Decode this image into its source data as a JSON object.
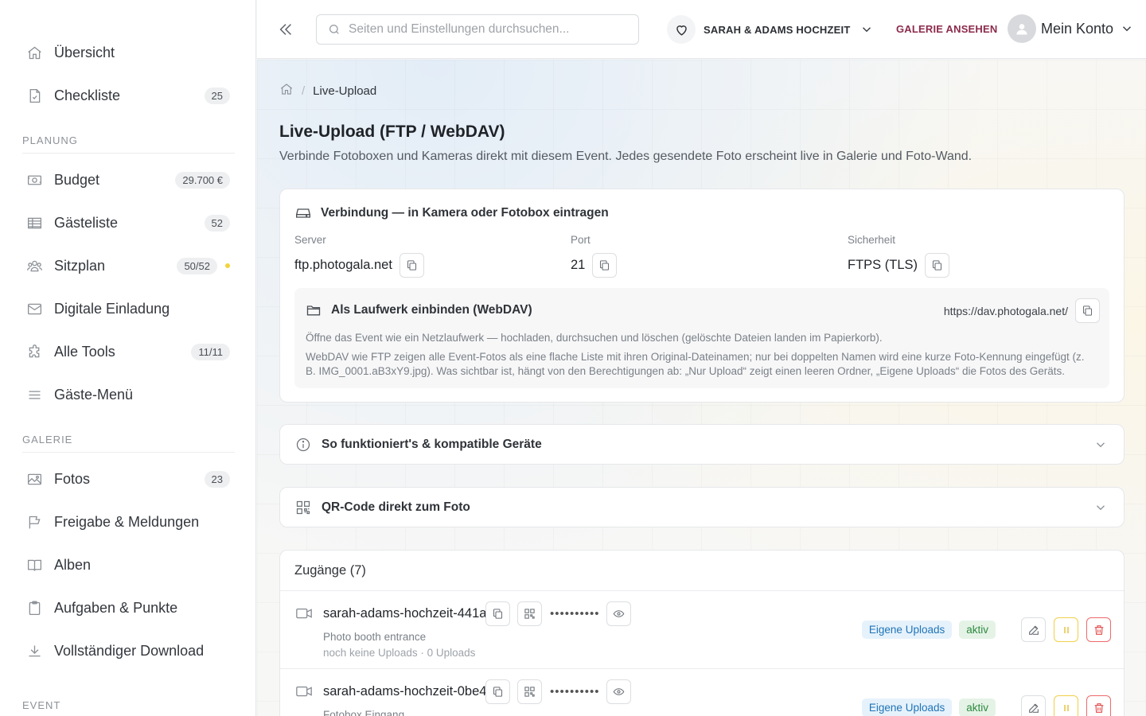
{
  "sidebar": {
    "items_top": [
      {
        "label": "Übersicht",
        "icon": "home-icon"
      },
      {
        "label": "Checkliste",
        "icon": "checklist-icon",
        "badge": "25"
      }
    ],
    "planung_label": "PLANUNG",
    "items_planung": [
      {
        "label": "Budget",
        "icon": "money-icon",
        "badge": "29.700 €"
      },
      {
        "label": "Gästeliste",
        "icon": "table-icon",
        "badge": "52"
      },
      {
        "label": "Sitzplan",
        "icon": "users-icon",
        "badge": "50/52",
        "dot": true
      },
      {
        "label": "Digitale Einladung",
        "icon": "mail-icon"
      },
      {
        "label": "Alle Tools",
        "icon": "puzzle-icon",
        "badge": "11/11"
      },
      {
        "label": "Gäste-Menü",
        "icon": "menu-icon"
      }
    ],
    "galerie_label": "GALERIE",
    "items_galerie": [
      {
        "label": "Fotos",
        "icon": "image-icon",
        "badge": "23"
      },
      {
        "label": "Freigabe & Meldungen",
        "icon": "flag-icon"
      },
      {
        "label": "Alben",
        "icon": "book-icon"
      },
      {
        "label": "Aufgaben & Punkte",
        "icon": "clipboard-icon"
      },
      {
        "label": "Vollständiger Download",
        "icon": "download-icon"
      }
    ],
    "event_label": "EVENT"
  },
  "topbar": {
    "search_placeholder": "Seiten und Einstellungen durchsuchen...",
    "event_name": "SARAH & ADAMS HOCHZEIT",
    "gallery_link": "GALERIE ANSEHEN",
    "account_label": "Mein Konto"
  },
  "breadcrumb": {
    "current": "Live-Upload"
  },
  "page": {
    "title": "Live-Upload (FTP / WebDAV)",
    "subtitle": "Verbinde Fotoboxen und Kameras direkt mit diesem Event. Jedes gesendete Foto erscheint live in Galerie und Foto-Wand."
  },
  "connection": {
    "heading": "Verbindung — in Kamera oder Fotobox eintragen",
    "server_label": "Server",
    "server_value": "ftp.photogala.net",
    "port_label": "Port",
    "port_value": "21",
    "security_label": "Sicherheit",
    "security_value": "FTPS (TLS)",
    "webdav_heading": "Als Laufwerk einbinden (WebDAV)",
    "webdav_url": "https://dav.photogala.net/",
    "webdav_p1": "Öffne das Event wie ein Netzlaufwerk — hochladen, durchsuchen und löschen (gelöschte Dateien landen im Papierkorb).",
    "webdav_p2": "WebDAV wie FTP zeigen alle Event-Fotos als eine flache Liste mit ihren Original-Dateinamen; nur bei doppelten Namen wird eine kurze Foto-Kennung eingefügt (z. B. IMG_0001.aB3xY9.jpg). Was sichtbar ist, hängt von den Berechtigungen ab: „Nur Upload“ zeigt einen leeren Ordner, „Eigene Uploads“ die Fotos des Geräts."
  },
  "accordions": {
    "how_it_works": "So funktioniert's & kompatible Geräte",
    "qr_code": "QR-Code direkt zum Foto"
  },
  "access": {
    "title": "Zugänge (7)",
    "rows": [
      {
        "name": "sarah-adams-hochzeit-441a",
        "password_mask": "••••••••••",
        "description": "Photo booth entrance",
        "meta": "noch keine Uploads · 0 Uploads",
        "permission": "Eigene Uploads",
        "status": "aktiv"
      },
      {
        "name": "sarah-adams-hochzeit-0be4",
        "password_mask": "••••••••••",
        "description": "Fotobox Eingang",
        "meta": "",
        "permission": "Eigene Uploads",
        "status": "aktiv"
      }
    ]
  },
  "colors": {
    "accent": "#8c2b4c",
    "status_green": "#2e8a3f",
    "permission_blue": "#1f74b8",
    "pause_yellow": "#e0b316",
    "delete_red": "#e24b4b"
  }
}
